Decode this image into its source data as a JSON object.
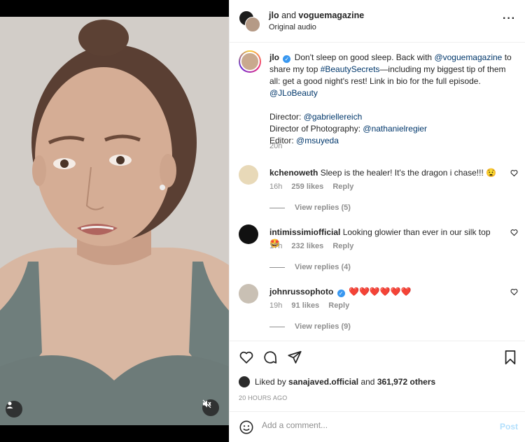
{
  "header": {
    "user_a": "jlo",
    "joiner": "and",
    "user_b": "voguemagazine",
    "audio": "Original audio",
    "more_icon": "more-horizontal-icon"
  },
  "caption": {
    "username": "jlo",
    "text_1": "Don't sleep on good sleep. Back with ",
    "mention_1": "@voguemagazine",
    "text_2": " to share my top ",
    "hashtag": "#BeautySecrets",
    "text_3": "—including my biggest tip of them all: get a good night's rest! Link in bio for the full episode. ",
    "mention_2": "@JLoBeauty",
    "director_label": "Director: ",
    "director": "@gabriellereich",
    "dop_label": "Director of Photography: ",
    "dop": "@nathanielregier",
    "editor_label": "Editor: ",
    "editor": "@msuyeda",
    "time": "20h"
  },
  "comments": [
    {
      "username": "kchenoweth",
      "text": "Sleep is the healer! It's the dragon i chase!!! 😧",
      "time": "16h",
      "likes": "259 likes",
      "reply": "Reply",
      "view_replies": "View replies (5)",
      "avatar_color": "#e8d9b8"
    },
    {
      "username": "intimissimiofficial",
      "text": "Looking glowier than ever in our silk top 🤩",
      "time": "17h",
      "likes": "232 likes",
      "reply": "Reply",
      "view_replies": "View replies (4)",
      "avatar_color": "#111111"
    },
    {
      "username": "johnrussophoto",
      "text": "❤️❤️❤️❤️❤️❤️",
      "time": "19h",
      "likes": "91 likes",
      "reply": "Reply",
      "view_replies": "View replies (9)",
      "avatar_color": "#c9c0b4"
    }
  ],
  "actions": {
    "like_icon": "heart-icon",
    "comment_icon": "comment-icon",
    "share_icon": "share-icon",
    "save_icon": "bookmark-icon",
    "liked_by_prefix": "Liked by ",
    "liked_by_user": "sanajaved.official",
    "liked_by_and": " and ",
    "liked_by_count": "361,972 others",
    "posted_ago": "20 HOURS AGO"
  },
  "add_comment": {
    "placeholder": "Add a comment...",
    "post_label": "Post",
    "emoji_icon": "emoji-icon"
  },
  "colors": {
    "link": "#00376b",
    "verified": "#3897f0",
    "post_disabled": "#b2dffc",
    "heart_red": "#ed4956"
  }
}
